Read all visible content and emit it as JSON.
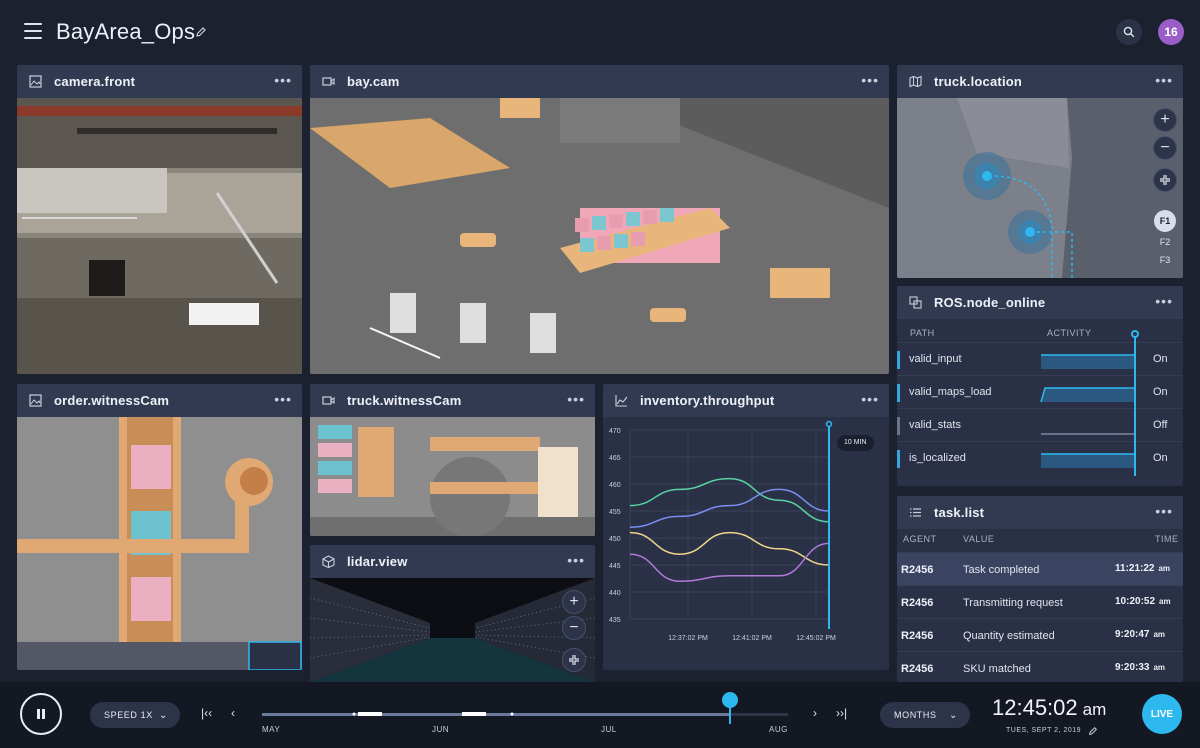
{
  "app": {
    "title": "BayArea_Ops",
    "avatar_count": "16"
  },
  "panels": {
    "camera_front": {
      "title": "camera.front",
      "menu": "•••"
    },
    "bay_cam": {
      "title": "bay.cam",
      "menu": "•••"
    },
    "truck_location": {
      "title": "truck.location",
      "menu": "•••",
      "floors": [
        "F1",
        "F2",
        "F3"
      ],
      "active_floor": "F1"
    },
    "ros_node": {
      "title": "ROS.node_online",
      "menu": "•••",
      "columns": [
        "PATH",
        "ACTIVITY"
      ],
      "rows": [
        {
          "path": "valid_input",
          "state": "On"
        },
        {
          "path": "valid_maps_load",
          "state": "On"
        },
        {
          "path": "valid_stats",
          "state": "Off"
        },
        {
          "path": "is_localized",
          "state": "On"
        }
      ]
    },
    "order_witness": {
      "title": "order.witnessCam",
      "menu": "•••"
    },
    "truck_witness": {
      "title": "truck.witnessCam",
      "menu": "•••"
    },
    "lidar": {
      "title": "lidar.view",
      "menu": "•••"
    },
    "throughput": {
      "title": "inventory.throughput",
      "menu": "•••",
      "window_badge": "10 MIN"
    },
    "task_list": {
      "title": "task.list",
      "menu": "•••",
      "columns": [
        "AGENT",
        "VALUE",
        "TIME"
      ],
      "rows": [
        {
          "agent": "R2456",
          "value": "Task completed",
          "time": "11:21:22",
          "ampm": "am"
        },
        {
          "agent": "R2456",
          "value": "Transmitting request",
          "time": "10:20:52",
          "ampm": "am"
        },
        {
          "agent": "R2456",
          "value": "Quantity estimated",
          "time": "9:20:47",
          "ampm": "am"
        },
        {
          "agent": "R2456",
          "value": "SKU matched",
          "time": "9:20:33",
          "ampm": "am"
        }
      ]
    }
  },
  "chart_data": {
    "type": "line",
    "x": [
      "12:37:02 PM",
      "12:41:02 PM",
      "12:45:02 PM"
    ],
    "ylim": [
      435,
      470
    ],
    "yticks": [
      470,
      465,
      460,
      455,
      450,
      445,
      440,
      435
    ],
    "series": [
      {
        "color": "#5ad0a0",
        "values": [
          456,
          459,
          461,
          457,
          453
        ]
      },
      {
        "color": "#7a8ff0",
        "values": [
          452,
          454,
          456,
          459,
          455
        ]
      },
      {
        "color": "#f0d58a",
        "values": [
          451,
          447,
          451,
          448,
          445
        ]
      },
      {
        "color": "#b07ad8",
        "values": [
          447,
          442,
          443,
          443,
          449
        ]
      }
    ]
  },
  "timeline": {
    "speed_label": "SPEED 1X",
    "months": [
      "MAY",
      "JUN",
      "JUL",
      "AUG"
    ],
    "zoom_label": "MONTHS",
    "clock": "12:45:02",
    "clock_ampm": "am",
    "date": "TUES, SEPT 2, 2019",
    "live_label": "LIVE",
    "progress": 0.89
  },
  "colors": {
    "accent": "#2db9f0",
    "avatar": "#9b5ec9"
  }
}
